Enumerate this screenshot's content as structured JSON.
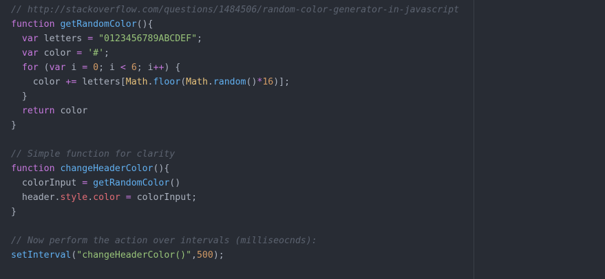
{
  "editor": {
    "colors": {
      "background": "#282c34",
      "comment": "#5c6370",
      "keyword": "#c678dd",
      "function": "#61afef",
      "string": "#98c379",
      "number": "#d19a66",
      "operator": "#c678dd",
      "builtin": "#e5c07b",
      "property": "#e06c75",
      "plain": "#abb2bf",
      "punct": "#abb2bf"
    },
    "lines": [
      [
        {
          "t": "comment",
          "v": "// http://stackoverflow.com/questions/1484506/random-color-generator-in-javascript"
        }
      ],
      [
        {
          "t": "keyword",
          "v": "function"
        },
        {
          "t": "plain",
          "v": " "
        },
        {
          "t": "function",
          "v": "getRandomColor"
        },
        {
          "t": "punct",
          "v": "(){"
        }
      ],
      [
        {
          "t": "plain",
          "v": "  "
        },
        {
          "t": "keyword",
          "v": "var"
        },
        {
          "t": "plain",
          "v": " letters "
        },
        {
          "t": "operator",
          "v": "="
        },
        {
          "t": "plain",
          "v": " "
        },
        {
          "t": "string",
          "v": "\"0123456789ABCDEF\""
        },
        {
          "t": "punct",
          "v": ";"
        }
      ],
      [
        {
          "t": "plain",
          "v": "  "
        },
        {
          "t": "keyword",
          "v": "var"
        },
        {
          "t": "plain",
          "v": " color "
        },
        {
          "t": "operator",
          "v": "="
        },
        {
          "t": "plain",
          "v": " "
        },
        {
          "t": "string",
          "v": "'#'"
        },
        {
          "t": "punct",
          "v": ";"
        }
      ],
      [
        {
          "t": "plain",
          "v": "  "
        },
        {
          "t": "keyword",
          "v": "for"
        },
        {
          "t": "plain",
          "v": " ("
        },
        {
          "t": "keyword",
          "v": "var"
        },
        {
          "t": "plain",
          "v": " i "
        },
        {
          "t": "operator",
          "v": "="
        },
        {
          "t": "plain",
          "v": " "
        },
        {
          "t": "number",
          "v": "0"
        },
        {
          "t": "punct",
          "v": "; "
        },
        {
          "t": "plain",
          "v": "i "
        },
        {
          "t": "operator",
          "v": "<"
        },
        {
          "t": "plain",
          "v": " "
        },
        {
          "t": "number",
          "v": "6"
        },
        {
          "t": "punct",
          "v": "; "
        },
        {
          "t": "plain",
          "v": "i"
        },
        {
          "t": "operator",
          "v": "++"
        },
        {
          "t": "plain",
          "v": ") {"
        }
      ],
      [
        {
          "t": "plain",
          "v": "    color "
        },
        {
          "t": "operator",
          "v": "+="
        },
        {
          "t": "plain",
          "v": " letters["
        },
        {
          "t": "builtin",
          "v": "Math"
        },
        {
          "t": "punct",
          "v": "."
        },
        {
          "t": "function",
          "v": "floor"
        },
        {
          "t": "plain",
          "v": "("
        },
        {
          "t": "builtin",
          "v": "Math"
        },
        {
          "t": "punct",
          "v": "."
        },
        {
          "t": "function",
          "v": "random"
        },
        {
          "t": "plain",
          "v": "()"
        },
        {
          "t": "operator",
          "v": "*"
        },
        {
          "t": "number",
          "v": "16"
        },
        {
          "t": "plain",
          "v": ")];"
        }
      ],
      [
        {
          "t": "plain",
          "v": "  }"
        }
      ],
      [
        {
          "t": "plain",
          "v": "  "
        },
        {
          "t": "keyword",
          "v": "return"
        },
        {
          "t": "plain",
          "v": " color"
        }
      ],
      [
        {
          "t": "plain",
          "v": "}"
        }
      ],
      [],
      [
        {
          "t": "comment",
          "v": "// Simple function for clarity"
        }
      ],
      [
        {
          "t": "keyword",
          "v": "function"
        },
        {
          "t": "plain",
          "v": " "
        },
        {
          "t": "function",
          "v": "changeHeaderColor"
        },
        {
          "t": "punct",
          "v": "(){"
        }
      ],
      [
        {
          "t": "plain",
          "v": "  colorInput "
        },
        {
          "t": "operator",
          "v": "="
        },
        {
          "t": "plain",
          "v": " "
        },
        {
          "t": "function",
          "v": "getRandomColor"
        },
        {
          "t": "plain",
          "v": "()"
        }
      ],
      [
        {
          "t": "plain",
          "v": "  header"
        },
        {
          "t": "punct",
          "v": "."
        },
        {
          "t": "property",
          "v": "style"
        },
        {
          "t": "punct",
          "v": "."
        },
        {
          "t": "property",
          "v": "color"
        },
        {
          "t": "plain",
          "v": " "
        },
        {
          "t": "operator",
          "v": "="
        },
        {
          "t": "plain",
          "v": " colorInput;"
        }
      ],
      [
        {
          "t": "plain",
          "v": "}"
        }
      ],
      [],
      [
        {
          "t": "comment",
          "v": "// Now perform the action over intervals (milliseocnds):"
        }
      ],
      [
        {
          "t": "function",
          "v": "setInterval"
        },
        {
          "t": "plain",
          "v": "("
        },
        {
          "t": "string",
          "v": "\"changeHeaderColor()\""
        },
        {
          "t": "punct",
          "v": ","
        },
        {
          "t": "number",
          "v": "500"
        },
        {
          "t": "plain",
          "v": ");"
        }
      ]
    ]
  }
}
